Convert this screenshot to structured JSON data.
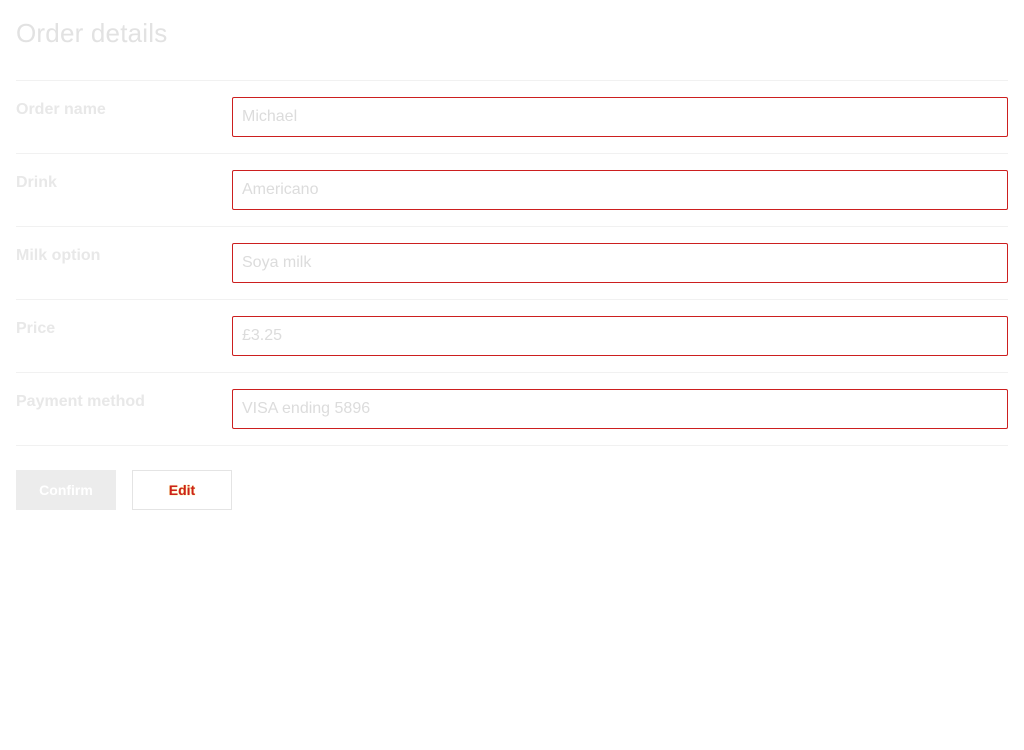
{
  "page": {
    "title": "Order details"
  },
  "fields": [
    {
      "label": "Order name",
      "value": "Michael"
    },
    {
      "label": "Drink",
      "value": "Americano"
    },
    {
      "label": "Milk option",
      "value": "Soya milk"
    },
    {
      "label": "Price",
      "value": "£3.25"
    },
    {
      "label": "Payment method",
      "value": "VISA ending 5896"
    }
  ],
  "actions": {
    "confirm_label": "Confirm",
    "edit_label": "Edit"
  },
  "colors": {
    "input_border": "#cc1f1f",
    "edit_text": "#cc1f1f",
    "edit_highlight": "#f2d200"
  }
}
